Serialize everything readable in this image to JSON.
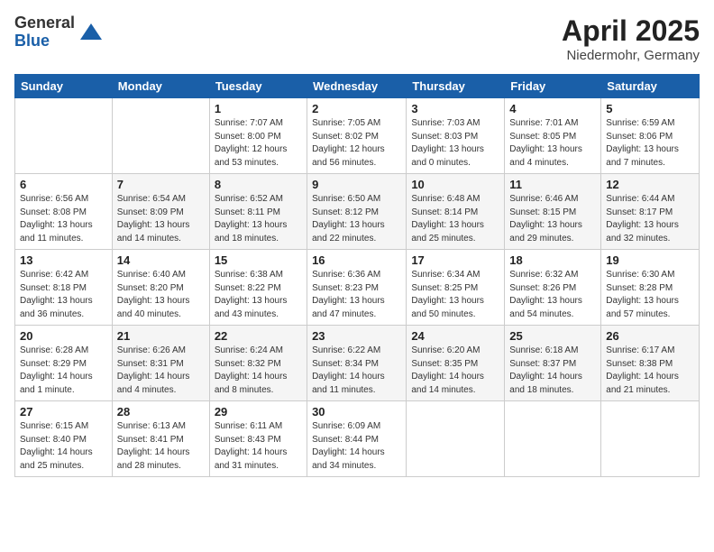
{
  "logo": {
    "general": "General",
    "blue": "Blue"
  },
  "title": {
    "month": "April 2025",
    "location": "Niedermohr, Germany"
  },
  "weekdays": [
    "Sunday",
    "Monday",
    "Tuesday",
    "Wednesday",
    "Thursday",
    "Friday",
    "Saturday"
  ],
  "weeks": [
    [
      {
        "day": "",
        "info": ""
      },
      {
        "day": "",
        "info": ""
      },
      {
        "day": "1",
        "info": "Sunrise: 7:07 AM\nSunset: 8:00 PM\nDaylight: 12 hours\nand 53 minutes."
      },
      {
        "day": "2",
        "info": "Sunrise: 7:05 AM\nSunset: 8:02 PM\nDaylight: 12 hours\nand 56 minutes."
      },
      {
        "day": "3",
        "info": "Sunrise: 7:03 AM\nSunset: 8:03 PM\nDaylight: 13 hours\nand 0 minutes."
      },
      {
        "day": "4",
        "info": "Sunrise: 7:01 AM\nSunset: 8:05 PM\nDaylight: 13 hours\nand 4 minutes."
      },
      {
        "day": "5",
        "info": "Sunrise: 6:59 AM\nSunset: 8:06 PM\nDaylight: 13 hours\nand 7 minutes."
      }
    ],
    [
      {
        "day": "6",
        "info": "Sunrise: 6:56 AM\nSunset: 8:08 PM\nDaylight: 13 hours\nand 11 minutes."
      },
      {
        "day": "7",
        "info": "Sunrise: 6:54 AM\nSunset: 8:09 PM\nDaylight: 13 hours\nand 14 minutes."
      },
      {
        "day": "8",
        "info": "Sunrise: 6:52 AM\nSunset: 8:11 PM\nDaylight: 13 hours\nand 18 minutes."
      },
      {
        "day": "9",
        "info": "Sunrise: 6:50 AM\nSunset: 8:12 PM\nDaylight: 13 hours\nand 22 minutes."
      },
      {
        "day": "10",
        "info": "Sunrise: 6:48 AM\nSunset: 8:14 PM\nDaylight: 13 hours\nand 25 minutes."
      },
      {
        "day": "11",
        "info": "Sunrise: 6:46 AM\nSunset: 8:15 PM\nDaylight: 13 hours\nand 29 minutes."
      },
      {
        "day": "12",
        "info": "Sunrise: 6:44 AM\nSunset: 8:17 PM\nDaylight: 13 hours\nand 32 minutes."
      }
    ],
    [
      {
        "day": "13",
        "info": "Sunrise: 6:42 AM\nSunset: 8:18 PM\nDaylight: 13 hours\nand 36 minutes."
      },
      {
        "day": "14",
        "info": "Sunrise: 6:40 AM\nSunset: 8:20 PM\nDaylight: 13 hours\nand 40 minutes."
      },
      {
        "day": "15",
        "info": "Sunrise: 6:38 AM\nSunset: 8:22 PM\nDaylight: 13 hours\nand 43 minutes."
      },
      {
        "day": "16",
        "info": "Sunrise: 6:36 AM\nSunset: 8:23 PM\nDaylight: 13 hours\nand 47 minutes."
      },
      {
        "day": "17",
        "info": "Sunrise: 6:34 AM\nSunset: 8:25 PM\nDaylight: 13 hours\nand 50 minutes."
      },
      {
        "day": "18",
        "info": "Sunrise: 6:32 AM\nSunset: 8:26 PM\nDaylight: 13 hours\nand 54 minutes."
      },
      {
        "day": "19",
        "info": "Sunrise: 6:30 AM\nSunset: 8:28 PM\nDaylight: 13 hours\nand 57 minutes."
      }
    ],
    [
      {
        "day": "20",
        "info": "Sunrise: 6:28 AM\nSunset: 8:29 PM\nDaylight: 14 hours\nand 1 minute."
      },
      {
        "day": "21",
        "info": "Sunrise: 6:26 AM\nSunset: 8:31 PM\nDaylight: 14 hours\nand 4 minutes."
      },
      {
        "day": "22",
        "info": "Sunrise: 6:24 AM\nSunset: 8:32 PM\nDaylight: 14 hours\nand 8 minutes."
      },
      {
        "day": "23",
        "info": "Sunrise: 6:22 AM\nSunset: 8:34 PM\nDaylight: 14 hours\nand 11 minutes."
      },
      {
        "day": "24",
        "info": "Sunrise: 6:20 AM\nSunset: 8:35 PM\nDaylight: 14 hours\nand 14 minutes."
      },
      {
        "day": "25",
        "info": "Sunrise: 6:18 AM\nSunset: 8:37 PM\nDaylight: 14 hours\nand 18 minutes."
      },
      {
        "day": "26",
        "info": "Sunrise: 6:17 AM\nSunset: 8:38 PM\nDaylight: 14 hours\nand 21 minutes."
      }
    ],
    [
      {
        "day": "27",
        "info": "Sunrise: 6:15 AM\nSunset: 8:40 PM\nDaylight: 14 hours\nand 25 minutes."
      },
      {
        "day": "28",
        "info": "Sunrise: 6:13 AM\nSunset: 8:41 PM\nDaylight: 14 hours\nand 28 minutes."
      },
      {
        "day": "29",
        "info": "Sunrise: 6:11 AM\nSunset: 8:43 PM\nDaylight: 14 hours\nand 31 minutes."
      },
      {
        "day": "30",
        "info": "Sunrise: 6:09 AM\nSunset: 8:44 PM\nDaylight: 14 hours\nand 34 minutes."
      },
      {
        "day": "",
        "info": ""
      },
      {
        "day": "",
        "info": ""
      },
      {
        "day": "",
        "info": ""
      }
    ]
  ]
}
